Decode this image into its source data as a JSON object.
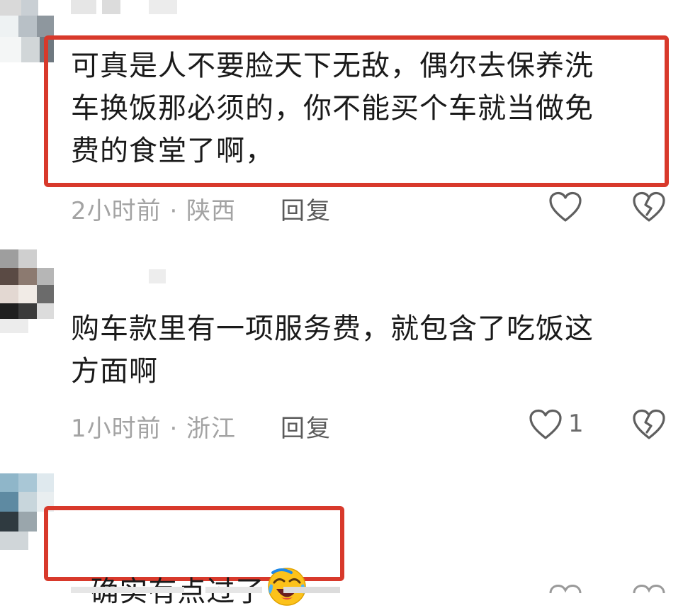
{
  "comments": [
    {
      "text": "可真是人不要脸天下无敌，偶尔去保养洗\n车换饭那必须的，你不能买个车就当做免\n费的食堂了啊，",
      "time": "2小时前",
      "location": "陕西",
      "meta": "2小时前 · 陕西",
      "reply_label": "回复",
      "likes": "",
      "highlighted": true
    },
    {
      "text": "购车款里有一项服务费，就包含了吃饭这\n方面啊",
      "time": "1小时前",
      "location": "浙江",
      "meta": "1小时前 · 浙江",
      "reply_label": "回复",
      "likes": "1",
      "highlighted": false
    },
    {
      "text": "确实有点过了",
      "emoji": "laughing-crying-emoji",
      "highlighted": true
    }
  ],
  "icons": {
    "like": "heart-outline-icon",
    "dislike": "broken-heart-icon"
  },
  "colors": {
    "highlight": "#d8392b",
    "meta_text": "#a3a3a3",
    "reply_text": "#5a5a5a"
  }
}
